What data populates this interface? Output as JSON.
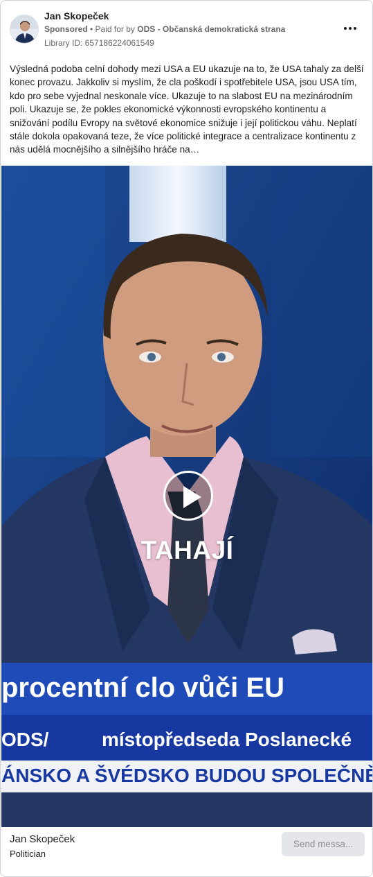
{
  "ad": {
    "advertiser_name": "Jan Skopeček",
    "sponsored_label": "Sponsored",
    "paid_for_prefix": " • Paid for by ",
    "paid_for_by": "ODS - Občanská demokratická strana",
    "library_id": "Library ID: 657186224061549",
    "more_options_icon": "more-horizontal-icon",
    "body_text": "Výsledná podoba celní dohody mezi USA a EU ukazuje na to, že USA tahaly za delší konec provazu. Jakkoliv si myslím, že cla poškodí i spotřebitele USA, jsou USA tím, kdo pro sebe vyjednal neskonale více. Ukazuje to na slabost EU na mezinárodním poli. Ukazuje se, že pokles ekonomické výkonnosti evropského kontinentu a snižování podílu Evropy na světové ekonomice snižuje i její politickou váhu. Neplatí stále dokola opakovaná teze, že více politické integrace a centralizace kontinentu z nás udělá mocnějšího a silnějšího hráče na…"
  },
  "video": {
    "caption": "TAHAJÍ",
    "play_icon": "play-icon",
    "tv_headline": "procentní clo vůči EU",
    "tv_party": "ODS/",
    "tv_role": "místopředseda Poslanecké",
    "tv_ticker": "ÁNSKO A ŠVÉDSKO BUDOU SPOLEČNĚ F"
  },
  "footer": {
    "page_name": "Jan Skopeček",
    "page_category": "Politician",
    "cta_button": "Send messa..."
  },
  "colors": {
    "studio_blue": "#1a3a7a",
    "banner_blue": "#1f4bb8",
    "banner_dark_blue": "#1738a0",
    "cta_background": "#e4e6eb"
  }
}
